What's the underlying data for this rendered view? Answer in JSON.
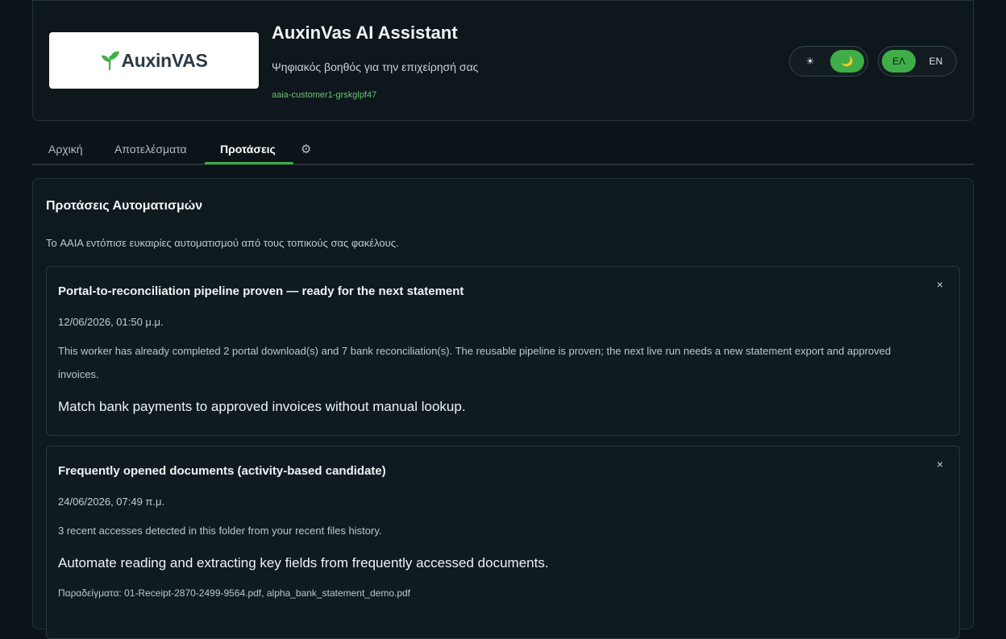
{
  "header": {
    "logo_word": "Auxin",
    "logo_word2": "VAS",
    "title": "AuxinVas AI Assistant",
    "subtitle": "Ψηφιακός βοηθός για την επιχείρησή σας",
    "instance_id": "aaia-customer1-grskglpf47",
    "theme": {
      "light_icon": "☀",
      "dark_icon": "🌙",
      "active": "dark"
    },
    "language": {
      "el_label": "ΕΛ",
      "en_label": "EN",
      "active": "ΕΛ"
    },
    "colors": {
      "accent": "#3fae48",
      "background": "#0b1418"
    }
  },
  "tabs": [
    {
      "label": "Αρχική",
      "active": false
    },
    {
      "label": "Αποτελέσματα",
      "active": false
    },
    {
      "label": "Προτάσεις",
      "active": true
    },
    {
      "label": "⚙",
      "icon": "gear-icon",
      "active": false
    }
  ],
  "panel": {
    "title": "Προτάσεις Αυτοματισμών",
    "description": "Το AAIA εντόπισε ευκαιρίες αυτοματισμού από τους τοπικούς σας φακέλους.",
    "cards": [
      {
        "title": "Portal-to-reconciliation pipeline proven — ready for the next statement",
        "date": "12/06/2026, 01:50 μ.μ.",
        "body": "This worker has already completed 2 portal download(s) and 7 bank reconciliation(s). The reusable pipeline is proven; the next live run needs a new statement export and approved invoices.",
        "goal": "Match bank payments to approved invoices without manual lookup.",
        "close": "×"
      },
      {
        "title": "Frequently opened documents (activity-based candidate)",
        "date": "24/06/2026, 07:49 π.μ.",
        "body": "3 recent accesses detected in this folder from your recent files history.",
        "goal": "Automate reading and extracting key fields from frequently accessed documents.",
        "examples": "Παραδείγματα: 01-Receipt-2870-2499-9564.pdf, alpha_bank_statement_demo.pdf",
        "close": "×"
      }
    ]
  }
}
